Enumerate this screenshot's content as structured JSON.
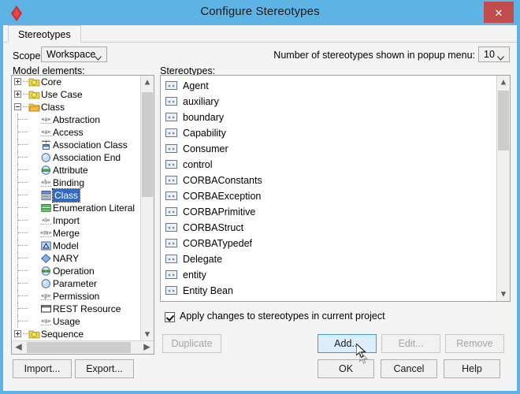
{
  "window": {
    "title": "Configure Stereotypes",
    "app_icon": "argouml-diamond-icon",
    "close_label": "✕"
  },
  "tabs": [
    {
      "label": "Stereotypes",
      "active": true
    }
  ],
  "scope": {
    "label": "Scope:",
    "value": "Workspace"
  },
  "popup_count": {
    "label": "Number of stereotypes shown in popup menu:",
    "value": "10"
  },
  "model_elements": {
    "label": "Model elements:",
    "items": [
      {
        "label": "Core",
        "depth": 0,
        "toggle": "plus",
        "icon": "folder-closed-icon"
      },
      {
        "label": "Use Case",
        "depth": 0,
        "toggle": "plus",
        "icon": "folder-closed-icon"
      },
      {
        "label": "Class",
        "depth": 0,
        "toggle": "minus",
        "icon": "folder-open-icon"
      },
      {
        "label": "Abstraction",
        "depth": 1,
        "toggle": "none",
        "icon": "stereotype-a-icon"
      },
      {
        "label": "Access",
        "depth": 1,
        "toggle": "none",
        "icon": "stereotype-a-icon"
      },
      {
        "label": "Association Class",
        "depth": 1,
        "toggle": "none",
        "icon": "association-class-icon"
      },
      {
        "label": "Association End",
        "depth": 1,
        "toggle": "none",
        "icon": "circle-blue-icon"
      },
      {
        "label": "Attribute",
        "depth": 1,
        "toggle": "none",
        "icon": "attribute-icon"
      },
      {
        "label": "Binding",
        "depth": 1,
        "toggle": "none",
        "icon": "stereotype-b-icon"
      },
      {
        "label": "Class",
        "depth": 1,
        "toggle": "none",
        "icon": "class-icon",
        "selected": true
      },
      {
        "label": "Enumeration Literal",
        "depth": 1,
        "toggle": "none",
        "icon": "enumeration-literal-icon"
      },
      {
        "label": "Import",
        "depth": 1,
        "toggle": "none",
        "icon": "stereotype-i-icon"
      },
      {
        "label": "Merge",
        "depth": 1,
        "toggle": "none",
        "icon": "stereotype-m-icon"
      },
      {
        "label": "Model",
        "depth": 1,
        "toggle": "none",
        "icon": "model-icon"
      },
      {
        "label": "NARY",
        "depth": 1,
        "toggle": "none",
        "icon": "diamond-blue-icon"
      },
      {
        "label": "Operation",
        "depth": 1,
        "toggle": "none",
        "icon": "operation-icon"
      },
      {
        "label": "Parameter",
        "depth": 1,
        "toggle": "none",
        "icon": "circle-blue-icon"
      },
      {
        "label": "Permission",
        "depth": 1,
        "toggle": "none",
        "icon": "stereotype-p-icon"
      },
      {
        "label": "REST Resource",
        "depth": 1,
        "toggle": "none",
        "icon": "rest-resource-icon"
      },
      {
        "label": "Usage",
        "depth": 1,
        "toggle": "none",
        "icon": "stereotype-u-icon"
      },
      {
        "label": "Sequence",
        "depth": 0,
        "toggle": "plus",
        "icon": "folder-closed-icon"
      }
    ]
  },
  "stereotypes": {
    "label": "Stereotypes:",
    "item_icon": "guillemet-stereotype-icon",
    "items": [
      "Agent",
      "auxiliary",
      "boundary",
      "Capability",
      "Consumer",
      "control",
      "CORBAConstants",
      "CORBAException",
      "CORBAPrimitive",
      "CORBAStruct",
      "CORBATypedef",
      "Delegate",
      "entity",
      "Entity Bean"
    ]
  },
  "apply_checkbox": {
    "label": "Apply changes to stereotypes in current project",
    "checked": true
  },
  "action_buttons": {
    "duplicate": "Duplicate",
    "add": "Add...",
    "edit": "Edit...",
    "remove": "Remove"
  },
  "footer_buttons": {
    "import": "Import...",
    "export": "Export...",
    "ok": "OK",
    "cancel": "Cancel",
    "help": "Help"
  },
  "colors": {
    "titlebar": "#5cb3e4",
    "close_button": "#c14c4c",
    "dialog_bg": "#f4f4f4",
    "selection": "#316ac5",
    "focus_button": "#dceefb",
    "scroll_thumb": "#cdcdcd"
  }
}
